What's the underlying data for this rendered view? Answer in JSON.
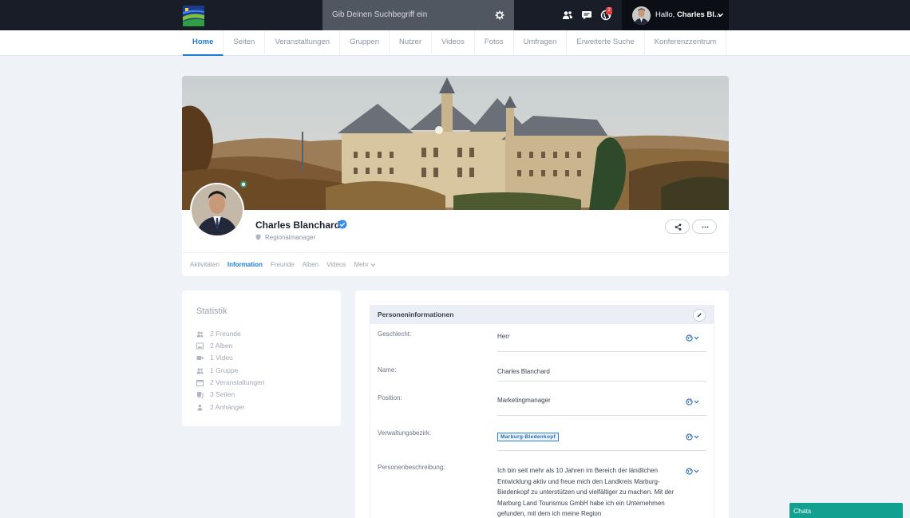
{
  "header": {
    "logo_icon": "site-logo-icon",
    "search_placeholder": "Gib Deinen Suchbegriff ein",
    "notification_count": "2",
    "greeting_prefix": "Hallo,",
    "user_name_short": "Charles Bl..."
  },
  "nav": {
    "items": [
      {
        "label": "Home",
        "active": true
      },
      {
        "label": "Seiten"
      },
      {
        "label": "Veranstaltungen"
      },
      {
        "label": "Gruppen"
      },
      {
        "label": "Nutzer"
      },
      {
        "label": "Videos"
      },
      {
        "label": "Fotos"
      },
      {
        "label": "Umfragen"
      },
      {
        "label": "Erweiterte Suche"
      },
      {
        "label": "Konferenzzentrum"
      }
    ]
  },
  "profile": {
    "name": "Charles Blanchard",
    "role": "Regionalmanager",
    "tabs": [
      "Aktivitäten",
      "Information",
      "Freunde",
      "Alben",
      "Videos",
      "Mehr"
    ],
    "active_tab": "Information"
  },
  "stats": {
    "title": "Statistik",
    "items": [
      {
        "icon": "users-icon",
        "label": "2 Freunde"
      },
      {
        "icon": "image-icon",
        "label": "2 Alben"
      },
      {
        "icon": "video-icon",
        "label": "1 Video"
      },
      {
        "icon": "group-icon",
        "label": "1 Gruppe"
      },
      {
        "icon": "calendar-icon",
        "label": "2 Veranstaltungen"
      },
      {
        "icon": "pages-icon",
        "label": "3 Seiten"
      },
      {
        "icon": "follower-icon",
        "label": "2 Anhänger"
      }
    ]
  },
  "info": {
    "title": "Personeninformationen",
    "fields": {
      "gender": {
        "label": "Geschlecht:",
        "value": "Herr"
      },
      "name": {
        "label": "Name:",
        "value": "Charles Blanchard"
      },
      "position": {
        "label": "Position:",
        "value": "Marketingmanager"
      },
      "district": {
        "label": "Verwaltungsbezirk:",
        "value": "Marburg-Biedenkopf"
      },
      "description": {
        "label": "Personenbeschreibung:",
        "value": "Ich bin seit mehr als 10 Jahren im Bereich der ländlichen Entwicklung aktiv und freue mich den Landkreis Marburg-Biedenkopf zu unterstützen und vielfältiger zu machen. Mit der Marburg Land Tourismus GmbH habe ich ein Unternehmen gefunden, mit dem ich meine Region"
      }
    }
  },
  "chats": {
    "label": "Chats"
  },
  "colors": {
    "accent": "#1f7ad8",
    "topbar": "#181d27",
    "chat": "#12a090",
    "badge": "#e53e3e"
  }
}
